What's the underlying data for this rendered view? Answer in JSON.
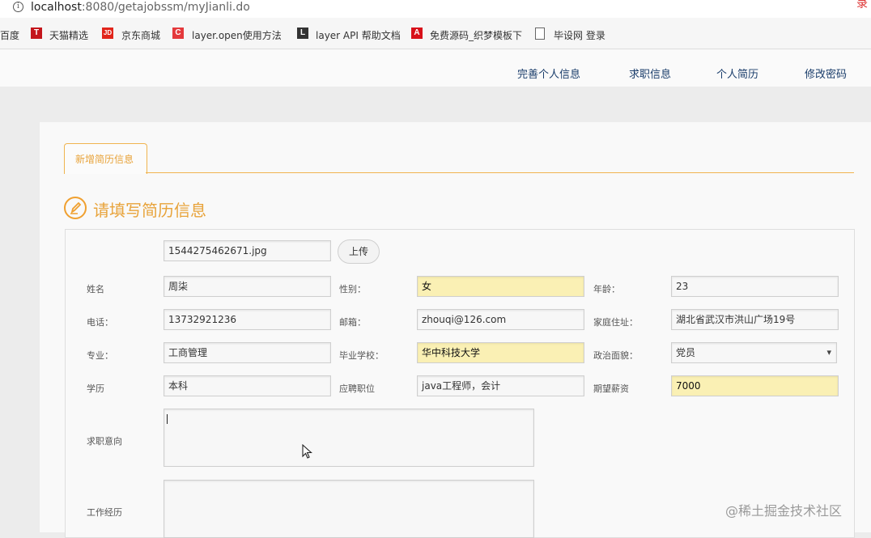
{
  "browser": {
    "host": "localhost",
    "path": ":8080/getajobssm/myJianli.do",
    "corner_text": "录"
  },
  "bookmarks": [
    {
      "label": "百度",
      "icon": ""
    },
    {
      "label": "天猫精选",
      "icon": "T"
    },
    {
      "label": "京东商城",
      "icon": "JD"
    },
    {
      "label": "layer.open使用方法",
      "icon": "C"
    },
    {
      "label": "layer API 帮助文档",
      "icon": "L"
    },
    {
      "label": "免费源码_织梦模板下",
      "icon": "A"
    },
    {
      "label": "毕设网 登录",
      "icon": "page-icon"
    }
  ],
  "nav": {
    "items": [
      "完善个人信息",
      "求职信息",
      "个人简历",
      "修改密码"
    ]
  },
  "tab": {
    "label": "新增简历信息"
  },
  "heading": "请填写简历信息",
  "form": {
    "photo_filename": "1544275462671.jpg",
    "upload_label": "上传",
    "labels": {
      "name": "姓名",
      "gender": "性别：",
      "age": "年龄：",
      "phone": "电话：",
      "email": "邮箱：",
      "address": "家庭住址：",
      "major": "专业：",
      "school": "毕业学校：",
      "political": "政治面貌：",
      "education": "学历",
      "position": "应聘职位",
      "salary": "期望薪资",
      "intention": "求职意向",
      "experience": "工作经历"
    },
    "values": {
      "name": "周柒",
      "gender": "女",
      "age": "23",
      "phone": "13732921236",
      "email": "zhouqi@126.com",
      "address": "湖北省武汉市洪山广场19号",
      "major": "工商管理",
      "school": "华中科技大学",
      "political": "党员",
      "education": "本科",
      "position": "java工程师，会计",
      "salary": "7000"
    }
  },
  "watermark": "@稀土掘金技术社区",
  "colors": {
    "accent": "#e8a33a",
    "nav_link": "#1a3d6b",
    "highlight": "#faf0b4"
  }
}
